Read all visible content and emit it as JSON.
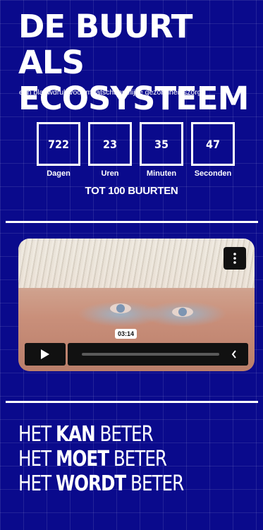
{
  "header": {
    "title": "DE BUURT ALS ECOSYSTEEM",
    "subtitle": "een blauwdruk voor maatschappelijke gezondheidszorg"
  },
  "countdown": {
    "units": [
      {
        "value": "722",
        "label": "Dagen"
      },
      {
        "value": "23",
        "label": "Uren"
      },
      {
        "value": "35",
        "label": "Minuten"
      },
      {
        "value": "47",
        "label": "Seconden"
      }
    ],
    "caption": "TOT 100 BUURTEN"
  },
  "video": {
    "timestamp": "03:14",
    "progress": 0.0,
    "icons": {
      "menu": "more-vertical-icon",
      "play": "play-icon",
      "collapse": "chevron-left-icon"
    }
  },
  "slogan": [
    {
      "pre": "HET ",
      "bold": "KAN",
      "post": " BETER"
    },
    {
      "pre": "HET ",
      "bold": "MOET",
      "post": " BETER"
    },
    {
      "pre": "HET ",
      "bold": "WORDT",
      "post": " BETER"
    }
  ],
  "colors": {
    "background": "#0a0a8c",
    "text": "#ffffff",
    "controls": "#111111"
  }
}
